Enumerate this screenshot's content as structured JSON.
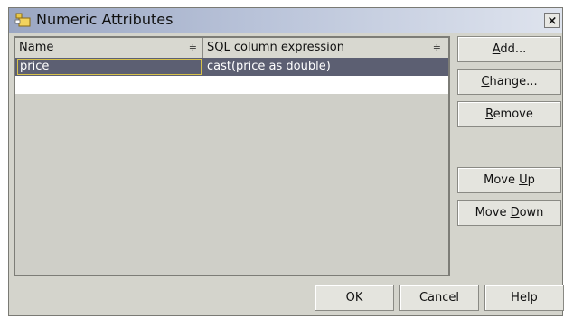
{
  "window": {
    "title": "Numeric Attributes",
    "close_label": "×"
  },
  "table": {
    "columns": [
      {
        "label": "Name",
        "sort_glyph": "≑"
      },
      {
        "label": "SQL column expression",
        "sort_glyph": "≑"
      }
    ],
    "rows": [
      {
        "name": "price",
        "expression": "cast(price as double)"
      }
    ]
  },
  "side_buttons": {
    "add": {
      "pre": "",
      "key": "A",
      "post": "dd..."
    },
    "change": {
      "pre": "",
      "key": "C",
      "post": "hange..."
    },
    "remove": {
      "pre": "",
      "key": "R",
      "post": "emove"
    },
    "move_up": {
      "pre": "Move ",
      "key": "U",
      "post": "p"
    },
    "move_down": {
      "pre": "Move ",
      "key": "D",
      "post": "own"
    }
  },
  "bottom_buttons": {
    "ok": "OK",
    "cancel": "Cancel",
    "help": "Help"
  },
  "colors": {
    "selection": "#5c5f72",
    "focus_border": "#d8c24a",
    "dialog_bg": "#d4d4cc"
  }
}
